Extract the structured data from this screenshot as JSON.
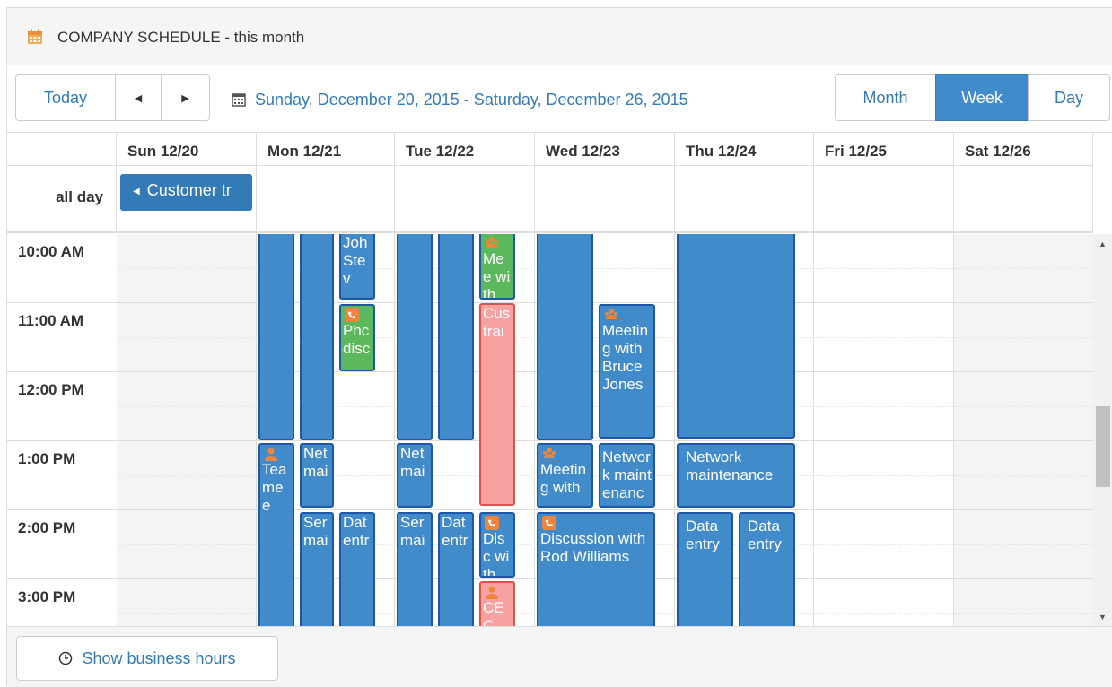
{
  "panel": {
    "title": "COMPANY SCHEDULE - this month",
    "icon": "calendar-icon"
  },
  "toolbar": {
    "today_label": "Today",
    "prev_label": "◀",
    "next_label": "▶",
    "date_range": "Sunday, December 20, 2015 - Saturday, December 26, 2015",
    "views": [
      "Month",
      "Week",
      "Day"
    ],
    "active_view": "Week"
  },
  "calendar": {
    "days": [
      "Sun 12/20",
      "Mon 12/21",
      "Tue 12/22",
      "Wed 12/23",
      "Thu 12/24",
      "Fri 12/25",
      "Sat 12/26"
    ],
    "allday_label": "all day",
    "allday_events": [
      {
        "title": "Customer tr",
        "color": "#337ab7"
      }
    ],
    "hours": [
      "10:00 AM",
      "11:00 AM",
      "12:00 PM",
      "1:00 PM",
      "2:00 PM",
      "3:00 PM"
    ],
    "events": [
      {
        "id": "e1",
        "text": "Joh Stev",
        "color": "#428bca"
      },
      {
        "id": "e2",
        "text": "Phc disc",
        "icon": "phone-icon",
        "color": "#5cb85c"
      },
      {
        "id": "e3",
        "text": "Tea mee",
        "icon": "user-icon",
        "color": "#428bca"
      },
      {
        "id": "e4",
        "text": "Net mai",
        "color": "#428bca"
      },
      {
        "id": "e5",
        "text": "Ser mai",
        "color": "#428bca"
      },
      {
        "id": "e6",
        "text": "Dat entr",
        "color": "#428bca"
      },
      {
        "id": "e7",
        "text": "Mee with",
        "icon": "group-icon",
        "color": "#5cb85c"
      },
      {
        "id": "e8",
        "text": "Cus trai",
        "color": "#f7a1a1"
      },
      {
        "id": "e9",
        "text": "Net mai",
        "color": "#428bca"
      },
      {
        "id": "e10",
        "text": "Ser mai",
        "color": "#428bca"
      },
      {
        "id": "e11",
        "text": "Dat entr",
        "color": "#428bca"
      },
      {
        "id": "e12",
        "text": "Disc with",
        "icon": "phone-icon",
        "color": "#428bca"
      },
      {
        "id": "e13",
        "text": "CEC",
        "icon": "user-icon",
        "color": "#f7a1a1"
      },
      {
        "id": "e14",
        "text": "Meeting with Bruce Jones",
        "icon": "group-icon",
        "color": "#428bca"
      },
      {
        "id": "e15",
        "text": "Meeting with",
        "icon": "group-icon",
        "color": "#428bca"
      },
      {
        "id": "e16",
        "text": "Network maintenance",
        "color": "#428bca"
      },
      {
        "id": "e17",
        "text": "Discussion with Rod Williams",
        "icon": "phone-icon",
        "color": "#428bca"
      },
      {
        "id": "e18",
        "text": "Network maintenance",
        "color": "#428bca"
      },
      {
        "id": "e19",
        "text": "Data entry",
        "color": "#428bca"
      },
      {
        "id": "e20",
        "text": "Data entry",
        "color": "#428bca"
      }
    ]
  },
  "footer": {
    "business_hours_label": "Show business hours"
  }
}
